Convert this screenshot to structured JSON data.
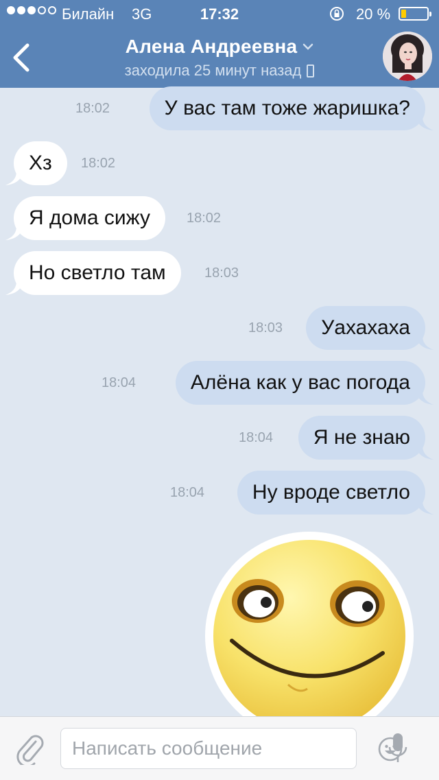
{
  "status_bar": {
    "carrier": "Билайн",
    "network": "3G",
    "time": "17:32",
    "battery": "20 %",
    "battery_level": 0.2
  },
  "header": {
    "title": "Алена Андреевна",
    "subtitle": "заходила 25 минут назад",
    "icons": [
      "back-chevron-icon",
      "chevron-down-icon",
      "phone-icon",
      "avatar"
    ]
  },
  "messages": [
    {
      "direction": "out",
      "text": "У вас там тоже жаришка?",
      "time": "18:02"
    },
    {
      "direction": "in",
      "text": "Хз",
      "time": "18:02"
    },
    {
      "direction": "in",
      "text": "Я дома сижу",
      "time": "18:02"
    },
    {
      "direction": "in",
      "text": "Но светло там",
      "time": "18:03"
    },
    {
      "direction": "out",
      "text": "Уахахаха",
      "time": "18:03"
    },
    {
      "direction": "out",
      "text": "Алёна как у вас погода",
      "time": "18:04"
    },
    {
      "direction": "out",
      "text": "Я не знаю",
      "time": "18:04"
    },
    {
      "direction": "out",
      "text": "Ну вроде светло",
      "time": "18:04"
    }
  ],
  "sticker": {
    "icon": "smiley-sticker"
  },
  "input": {
    "placeholder": "Написать сообщение",
    "icons": [
      "paperclip-icon",
      "emoji-icon",
      "microphone-icon"
    ]
  },
  "colors": {
    "header": "#5a84b7",
    "background": "#dfe7f1",
    "outgoing_bubble": "#cddcf0",
    "incoming_bubble": "#ffffff",
    "battery": "#ffcc00"
  }
}
